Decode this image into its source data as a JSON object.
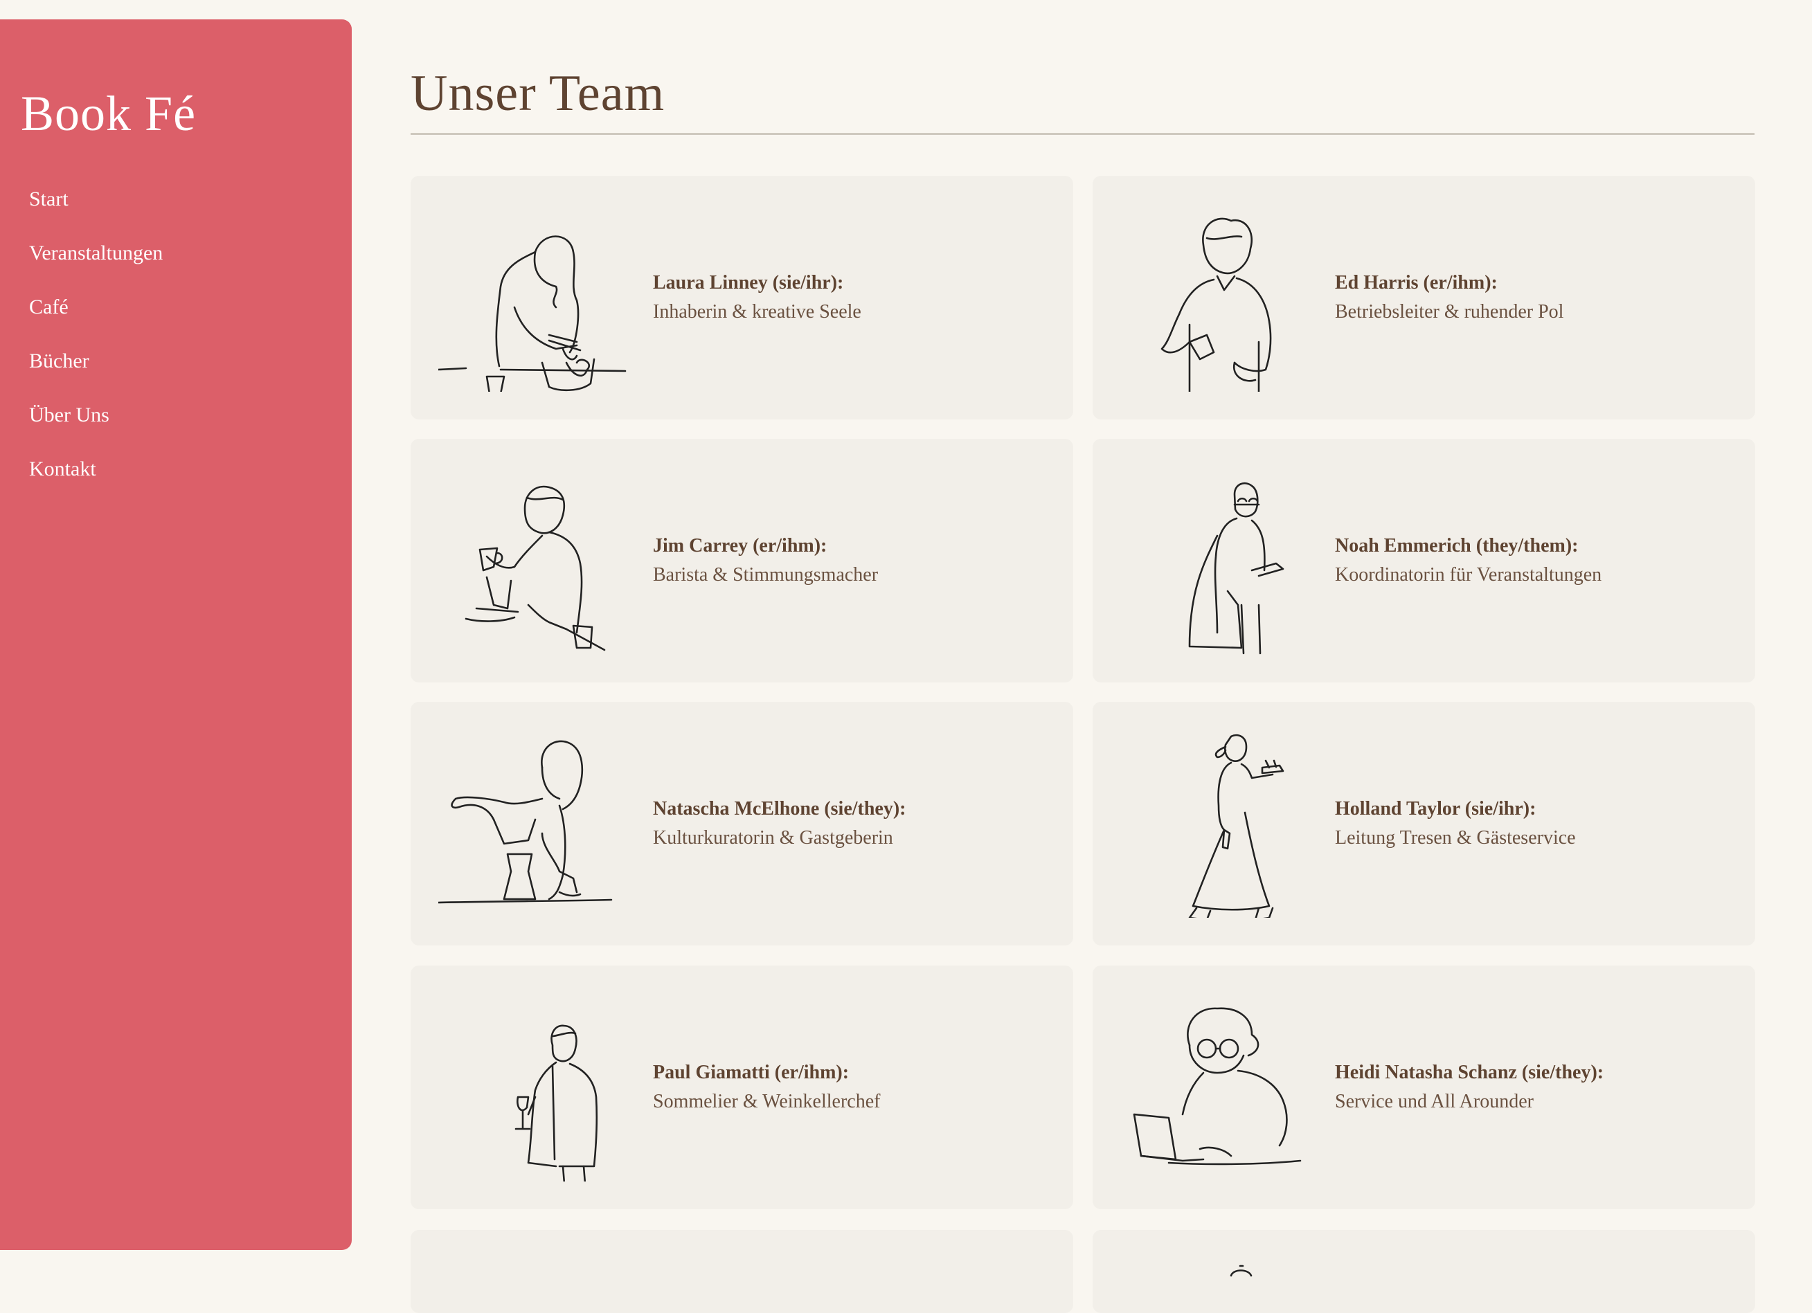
{
  "sidebar": {
    "brand": "Book Fé",
    "nav": [
      "Start",
      "Veranstaltungen",
      "Café",
      "Bücher",
      "Über Uns",
      "Kontakt"
    ]
  },
  "main": {
    "title": "Unser Team"
  },
  "team": [
    {
      "name": "Laura Linney (sie/ihr):",
      "role": "Inhaberin & kreative Seele",
      "illustration": "woman-writing-at-table-icon"
    },
    {
      "name": "Ed Harris (er/ihm):",
      "role": "Betriebsleiter & ruhender Pol",
      "illustration": "man-holding-cup-icon"
    },
    {
      "name": "Jim Carrey (er/ihm):",
      "role": "Barista & Stimmungsmacher",
      "illustration": "barista-pouring-coffee-icon"
    },
    {
      "name": "Noah Emmerich (they/them):",
      "role": "Koordinatorin für Veranstaltungen",
      "illustration": "person-with-bag-and-cup-icon"
    },
    {
      "name": "Natascha McElhone (sie/they):",
      "role": "Kulturkuratorin & Gastgeberin",
      "illustration": "woman-brewing-pour-over-icon"
    },
    {
      "name": "Holland Taylor (sie/ihr):",
      "role": "Leitung Tresen & Gästeservice",
      "illustration": "woman-carrying-tray-icon"
    },
    {
      "name": "Paul Giamatti (er/ihm):",
      "role": "Sommelier & Weinkellerchef",
      "illustration": "man-holding-wine-glass-icon"
    },
    {
      "name": "Heidi Natasha Schanz (sie/they):",
      "role": "Service und All Arounder",
      "illustration": "woman-with-laptop-icon"
    }
  ],
  "colors": {
    "sidebar": "#dc5f69",
    "background": "#f9f6f0",
    "card": "#f2efe9",
    "title": "#5e4331"
  }
}
